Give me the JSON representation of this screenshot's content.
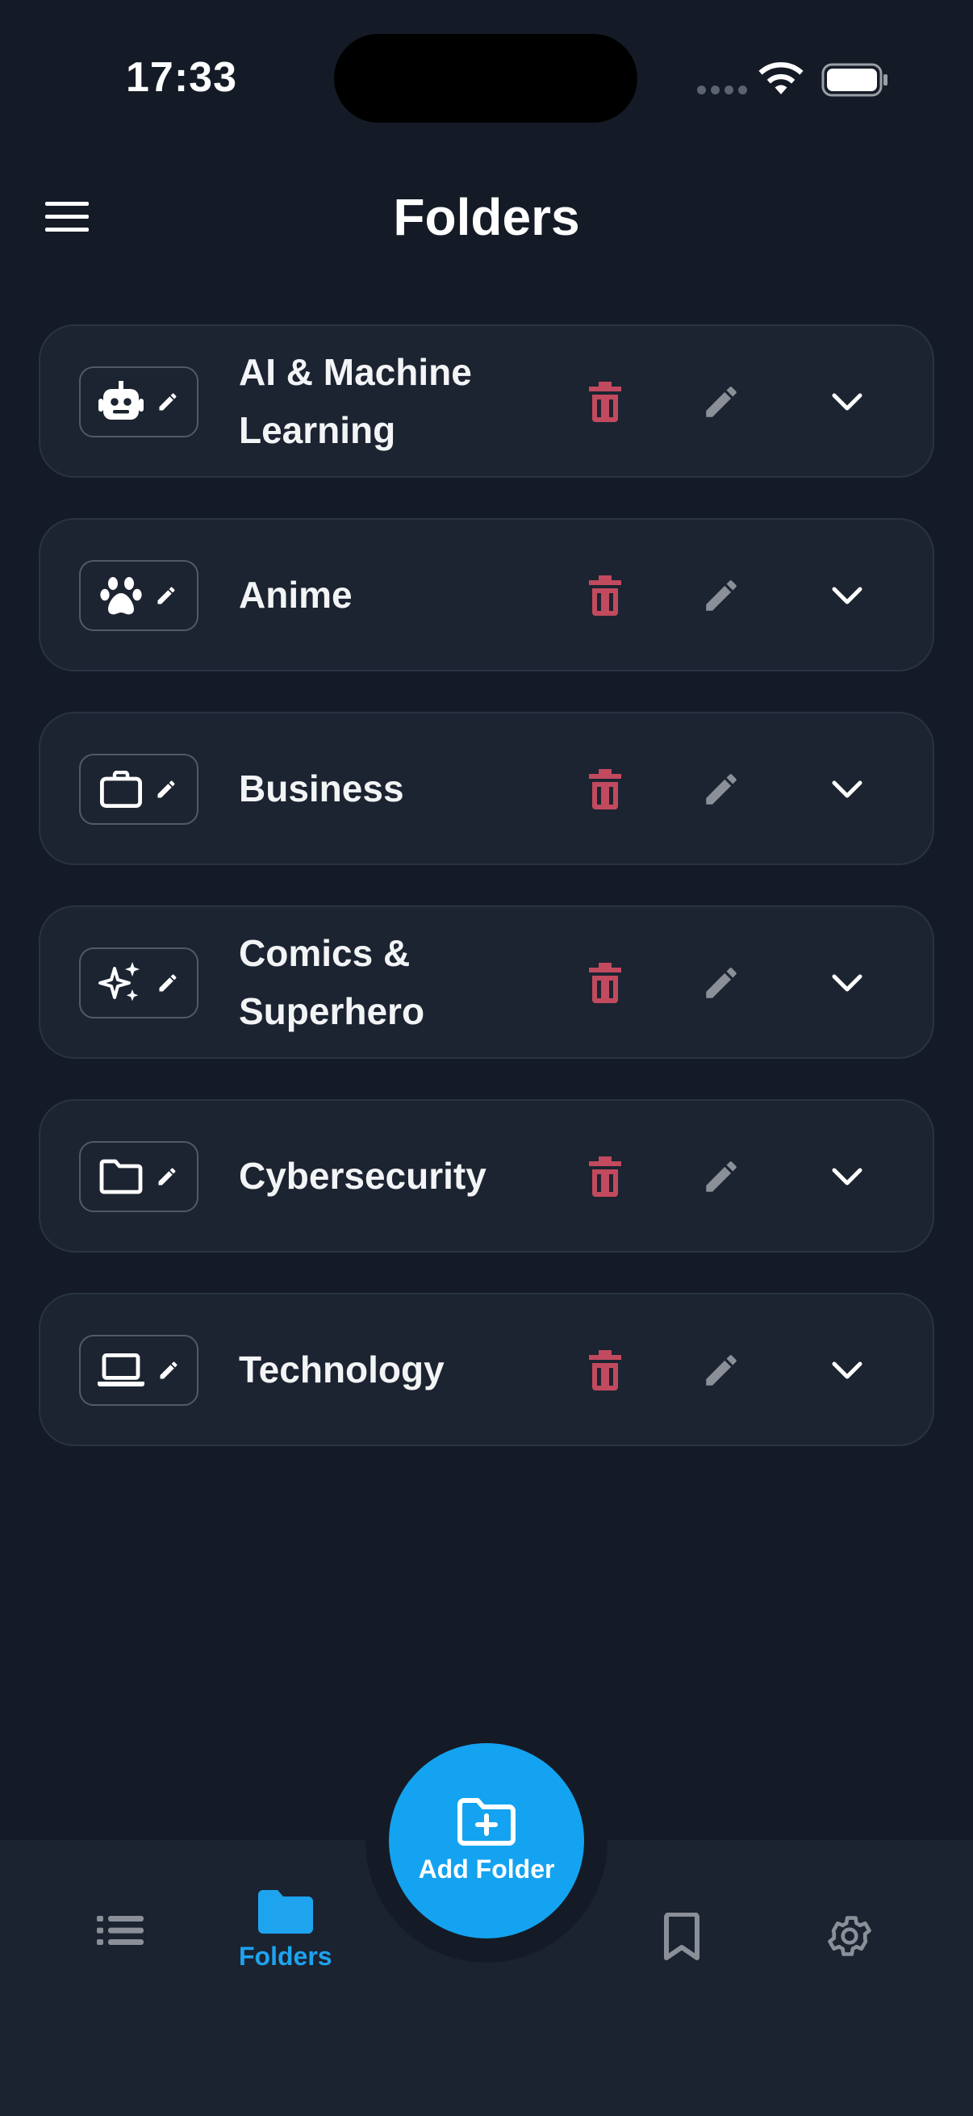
{
  "status_bar": {
    "time": "17:33"
  },
  "header": {
    "title": "Folders"
  },
  "folders": [
    {
      "name": "AI & Machine Learning",
      "icon": "robot-icon"
    },
    {
      "name": "Anime",
      "icon": "paw-icon"
    },
    {
      "name": "Business",
      "icon": "briefcase-icon"
    },
    {
      "name": "Comics & Superhero",
      "icon": "sparkles-icon"
    },
    {
      "name": "Cybersecurity",
      "icon": "folder-icon"
    },
    {
      "name": "Technology",
      "icon": "laptop-icon"
    }
  ],
  "fab": {
    "label": "Add Folder",
    "icon": "folder-add-icon"
  },
  "nav": {
    "folders_label": "Folders",
    "items": [
      "list-icon",
      "folder-icon",
      "bookmark-icon",
      "gear-icon"
    ]
  },
  "colors": {
    "background": "#151b26",
    "card": "#1c2431",
    "accent": "#14a3f0",
    "delete": "#c24a5e",
    "muted_icon": "#8a8f98"
  }
}
